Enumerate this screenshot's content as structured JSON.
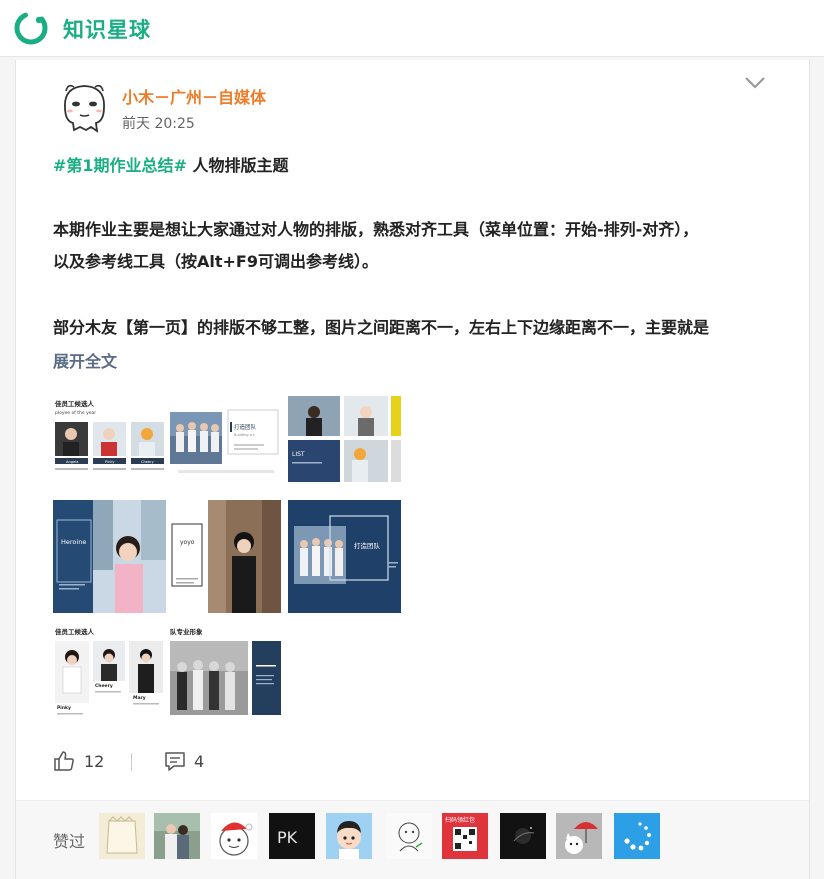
{
  "app": {
    "brand": "知识星球"
  },
  "post": {
    "author": "小木－广州－自媒体",
    "time": "前天 20:25",
    "hashtag": "#第1期作业总结#",
    "topic": " 人物排版主题",
    "para1_line1": "本期作业主要是想让大家通过对人物的排版，熟悉对齐工具（菜单位置：开始-排列-对齐），",
    "para1_line2": "以及参考线工具（按Alt+F9可调出参考线）。",
    "para2": "部分木友【第一页】的排版不够工整，图片之间距离不一，左右上下边缘距离不一，主要就是",
    "expand": "展开全文"
  },
  "images": {
    "img1": {
      "title": "佳员工候选人",
      "subtitle": "ployee of the year",
      "names": [
        "Angela",
        "Pinky",
        "Cheery"
      ]
    },
    "img2": {
      "title": "打造团队",
      "subtitle": "Building a t"
    },
    "img3": {
      "label": "LIST"
    },
    "img4": {
      "label": "Heroine"
    },
    "img5": {
      "label": "yoyo"
    },
    "img6": {
      "label": "打造团队"
    },
    "img7": {
      "title": "佳员工候选人",
      "names": [
        "Cheery",
        "Pinky",
        "Mary"
      ]
    },
    "img8": {
      "title": "队专业形象"
    }
  },
  "actions": {
    "likes": "12",
    "comments": "4"
  },
  "liked_by": {
    "label": "赞过",
    "avatars": [
      {
        "icon": "paper-bag-avatar",
        "bg": "#f3ecd6"
      },
      {
        "icon": "couple-photo-avatar",
        "bg": "#8aa08c"
      },
      {
        "icon": "santa-face-avatar",
        "bg": "#ffffff"
      },
      {
        "icon": "pk-logo-avatar",
        "text": "PK",
        "bg": "#111111"
      },
      {
        "icon": "cartoon-boy-avatar",
        "bg": "#9fd2f2"
      },
      {
        "icon": "sketch-avatar",
        "bg": "#fafafa"
      },
      {
        "icon": "red-qr-avatar",
        "text": "扫码领红包",
        "bg": "#e0343c"
      },
      {
        "icon": "dark-space-avatar",
        "bg": "#121212"
      },
      {
        "icon": "cat-umbrella-avatar",
        "bg": "#b8b8b8"
      },
      {
        "icon": "blue-loader-avatar",
        "bg": "#2d9fe6"
      }
    ]
  },
  "colors": {
    "brand": "#1aae84",
    "author": "#ee7d2a",
    "expand": "#5a6b86",
    "hashtag": "#1aae84"
  }
}
